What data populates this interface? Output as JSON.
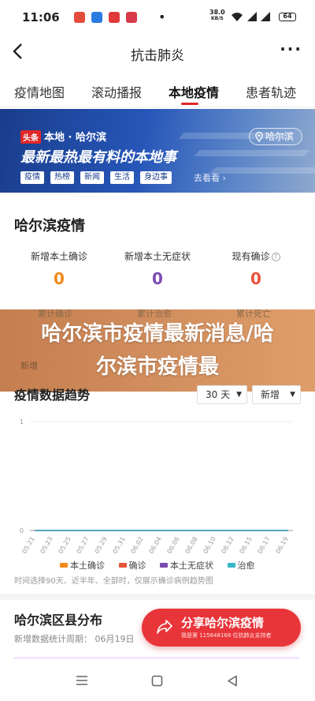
{
  "status_bar": {
    "time": "11:06",
    "network_speed": "38.0",
    "network_unit": "KB/S",
    "battery": "64",
    "dot": "•"
  },
  "header": {
    "title": "抗击肺炎",
    "back_icon": "chevron-left-icon",
    "more_icon": "more-dots-icon",
    "more_glyph": "···"
  },
  "tabs": [
    {
      "label": "疫情地图"
    },
    {
      "label": "滚动播报"
    },
    {
      "label": "本地疫情",
      "active": true
    },
    {
      "label": "患者轨迹"
    }
  ],
  "banner": {
    "logo": "头条",
    "brand": "本地 · 哈尔滨",
    "slogan": "最新最热最有料的本地事",
    "chips": [
      "疫情",
      "热榜",
      "新闻",
      "生活",
      "身边事"
    ],
    "more_link": "去看看 ›",
    "location": "哈尔滨"
  },
  "stats_section": {
    "title": "哈尔滨疫情",
    "items": [
      {
        "label": "新增本土确诊",
        "value": "0",
        "color": "#f08a1c"
      },
      {
        "label": "新增本土无症状",
        "value": "0",
        "color": "#7b4bb0"
      },
      {
        "label": "现有确诊",
        "value": "0",
        "color": "#e8533a",
        "info": "?"
      }
    ],
    "faded_labels": [
      "累计确诊",
      "累计治愈",
      "累计死亡"
    ],
    "faded_extra": "新增"
  },
  "overlay": {
    "headline": "哈尔滨市疫情最新消息/哈尔滨市疫情最"
  },
  "trend_section": {
    "title": "疫情数据趋势",
    "range_select": "30 天",
    "type_select": "新增",
    "note": "时间选择90天、近半年、全部时，仅展示确诊病例趋势图"
  },
  "chart_data": {
    "type": "line",
    "x": [
      "05.21",
      "05.23",
      "05.25",
      "05.27",
      "05.29",
      "05.31",
      "06.02",
      "06.04",
      "06.06",
      "06.08",
      "06.10",
      "06.12",
      "06.15",
      "06.17",
      "06.19"
    ],
    "y_ticks": [
      0,
      1
    ],
    "ylim": [
      0,
      1
    ],
    "series": [
      {
        "name": "本土确诊",
        "color": "#f08a1c",
        "values": [
          0,
          0,
          0,
          0,
          0,
          0,
          0,
          0,
          0,
          0,
          0,
          0,
          0,
          0,
          0
        ]
      },
      {
        "name": "确诊",
        "color": "#e8533a",
        "values": [
          0,
          0,
          0,
          0,
          0,
          0,
          0,
          0,
          0,
          0,
          0,
          0,
          0,
          0,
          0
        ]
      },
      {
        "name": "本土无症状",
        "color": "#7b4bb0",
        "values": [
          0,
          0,
          0,
          0,
          0,
          0,
          0,
          0,
          0,
          0,
          0,
          0,
          0,
          0,
          0
        ]
      },
      {
        "name": "治愈",
        "color": "#37b7c9",
        "values": [
          0,
          0,
          0,
          0,
          0,
          0,
          0,
          0,
          0,
          0,
          0,
          0,
          0,
          0,
          0
        ]
      }
    ],
    "grid": true
  },
  "district_section": {
    "title": "哈尔滨区县分布",
    "subtitle": "新增数据统计周期： 06月19日"
  },
  "share_button": {
    "label": "分享哈尔滨疫情",
    "sub": "我是第 115648168 位抗肺炎支持者"
  },
  "nav_bar": {
    "menu_icon": "menu-icon",
    "home_icon": "home-square-icon",
    "back_icon": "back-triangle-icon"
  },
  "colors": {
    "accent": "#e02828",
    "banner_blue": "#1f4ea6",
    "overlay_orange": "#c46a2a"
  }
}
